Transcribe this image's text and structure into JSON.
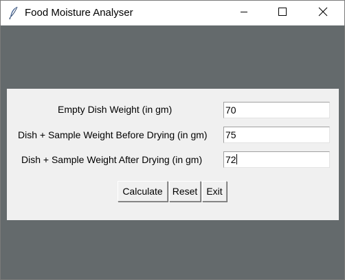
{
  "window": {
    "title": "Food Moisture Analyser",
    "app_icon": "feather-icon"
  },
  "title_controls": {
    "minimize_icon": "minimize-icon",
    "maximize_icon": "maximize-icon",
    "close_icon": "close-icon"
  },
  "form": {
    "fields": [
      {
        "label": "Empty Dish Weight (in gm)",
        "value": "70"
      },
      {
        "label": "Dish + Sample Weight Before Drying (in gm)",
        "value": "75"
      },
      {
        "label": "Dish + Sample Weight After Drying (in gm)",
        "value": "72"
      }
    ]
  },
  "buttons": {
    "calculate": "Calculate",
    "reset": "Reset",
    "exit": "Exit"
  },
  "colors": {
    "window_background": "#646a6c",
    "panel_background": "#f0f0f0"
  }
}
